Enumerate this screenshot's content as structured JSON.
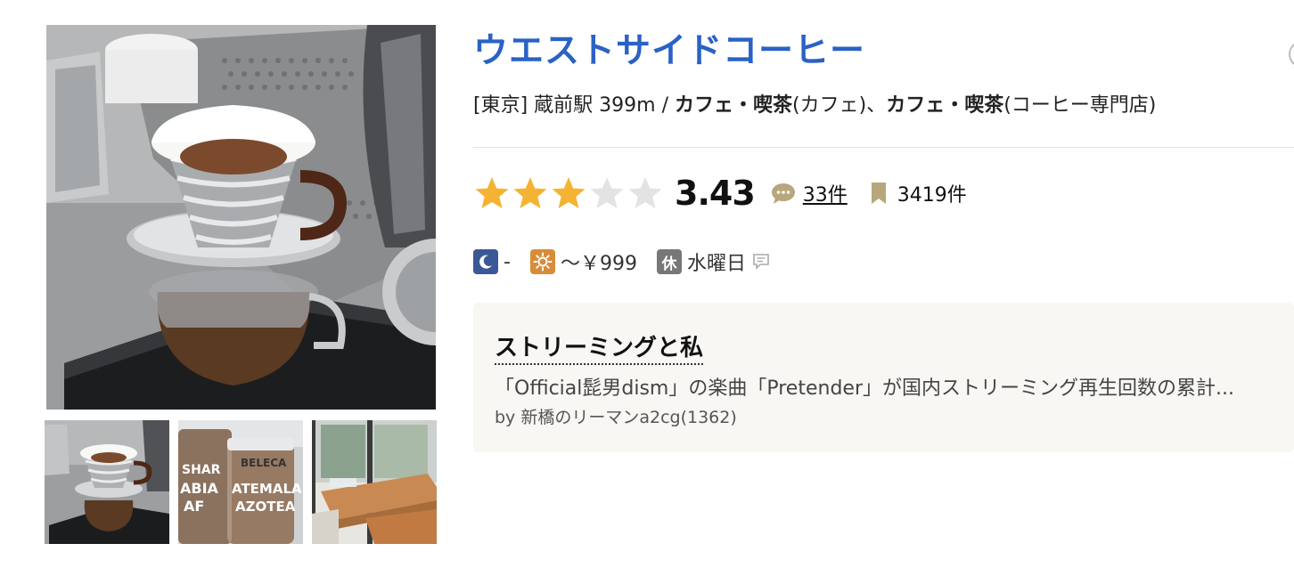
{
  "shop": {
    "name": "ウエストサイドコーヒー",
    "area": "[東京]",
    "station": "蔵前駅 399m",
    "separator": "/",
    "genre1_main": "カフェ・喫茶",
    "genre1_sub": "(カフェ)、",
    "genre2_main": "カフェ・喫茶",
    "genre2_sub": "(コーヒー専門店)"
  },
  "rating": {
    "score": "3.43",
    "stars_filled": 3,
    "stars_total": 5,
    "review_count": "33件",
    "bookmark_count": "3419件",
    "star_color": "#f5b333",
    "star_empty_color": "#e3e3e3"
  },
  "price": {
    "night_icon": "moon-icon",
    "night_label": "夜",
    "night_price": "-",
    "lunch_icon": "sun-icon",
    "lunch_price": "～￥999",
    "holiday_badge": "休",
    "holiday_text": "水曜日",
    "holiday_note_icon": "comment-icon"
  },
  "pickup": {
    "title": "ストリーミングと私",
    "body": "「Official髭男dism」の楽曲「Pretender」が国内ストリーミング再生回数の累計...",
    "by": "by 新橋のリーマンa2cg(1362)"
  },
  "colors": {
    "title": "#2a62c5",
    "night_badge": "#3b5896",
    "lunch_badge": "#d88c3a",
    "holiday_badge": "#777777"
  }
}
